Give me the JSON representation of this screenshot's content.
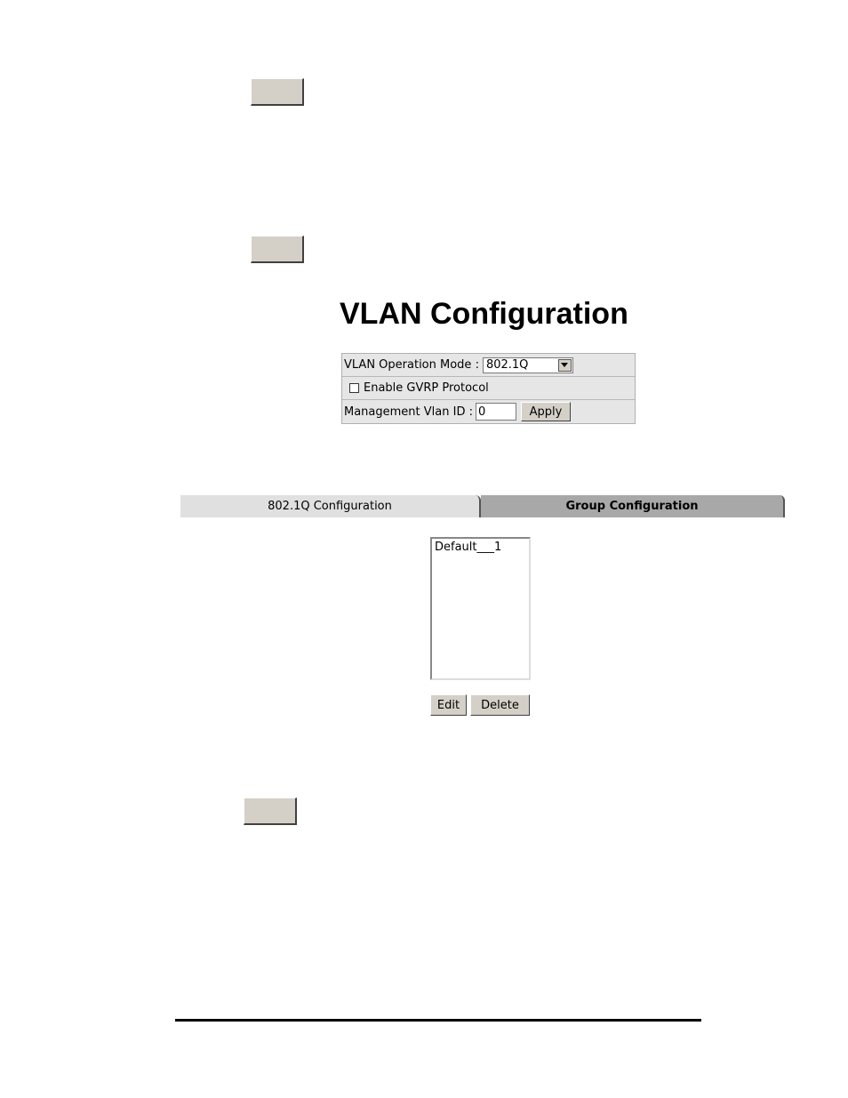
{
  "title": "VLAN Configuration",
  "vlan_settings": {
    "operation_mode_label": "VLAN Operation Mode :",
    "operation_mode_value": "802.1Q",
    "gvrp_label": "Enable GVRP Protocol",
    "gvrp_checked": false,
    "mgmt_vlan_label": "Management Vlan ID :",
    "mgmt_vlan_value": "0",
    "apply_label": "Apply"
  },
  "tabs": [
    {
      "label": "802.1Q Configuration",
      "active": false
    },
    {
      "label": "Group Configuration",
      "active": true
    }
  ],
  "group_list": {
    "items": [
      "Default___1"
    ],
    "edit_label": "Edit",
    "delete_label": "Delete"
  },
  "icons": {
    "dropdown": "chevron-down-icon"
  }
}
